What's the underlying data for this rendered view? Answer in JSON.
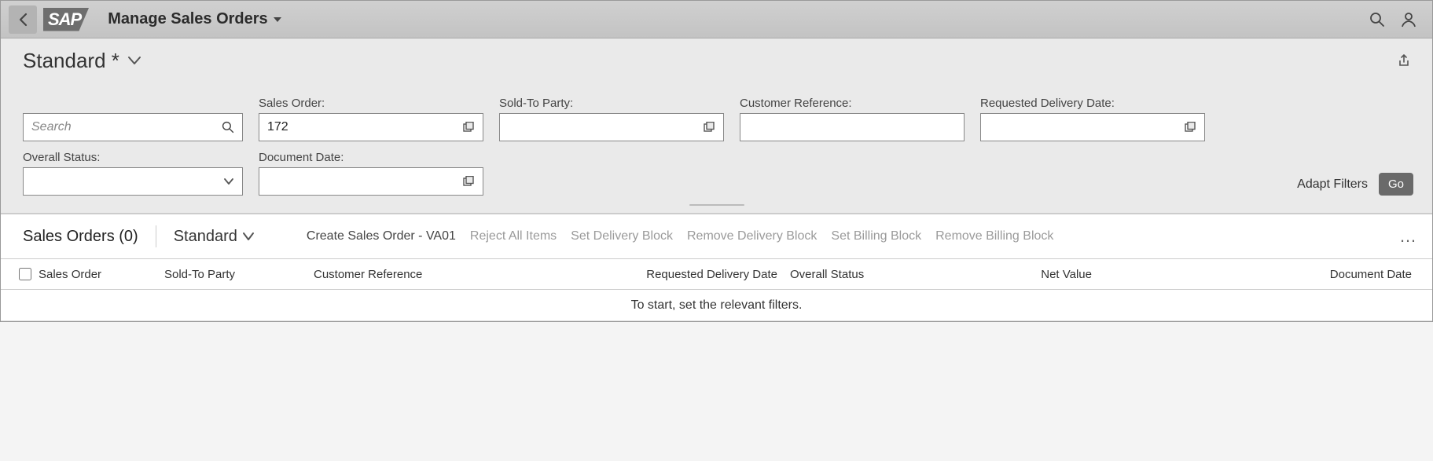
{
  "shell": {
    "logo_text": "SAP",
    "title": "Manage Sales Orders"
  },
  "variant": {
    "name": "Standard *"
  },
  "filters": {
    "search_placeholder": "Search",
    "sales_order": {
      "label": "Sales Order:",
      "value": "172"
    },
    "sold_to_party": {
      "label": "Sold-To Party:",
      "value": ""
    },
    "customer_reference": {
      "label": "Customer Reference:",
      "value": ""
    },
    "requested_delivery_date": {
      "label": "Requested Delivery Date:",
      "value": ""
    },
    "overall_status": {
      "label": "Overall Status:",
      "value": ""
    },
    "document_date": {
      "label": "Document Date:",
      "value": ""
    },
    "adapt_filters": "Adapt Filters",
    "go": "Go"
  },
  "table": {
    "title": "Sales Orders (0)",
    "variant": "Standard",
    "actions": {
      "create": "Create Sales Order - VA01",
      "reject": "Reject All Items",
      "set_delivery_block": "Set Delivery Block",
      "remove_delivery_block": "Remove Delivery Block",
      "set_billing_block": "Set Billing Block",
      "remove_billing_block": "Remove Billing Block"
    },
    "columns": {
      "sales_order": "Sales Order",
      "sold_to_party": "Sold-To Party",
      "customer_reference": "Customer Reference",
      "requested_delivery_date": "Requested Delivery Date",
      "overall_status": "Overall Status",
      "net_value": "Net Value",
      "document_date": "Document Date"
    },
    "empty_text": "To start, set the relevant filters."
  }
}
